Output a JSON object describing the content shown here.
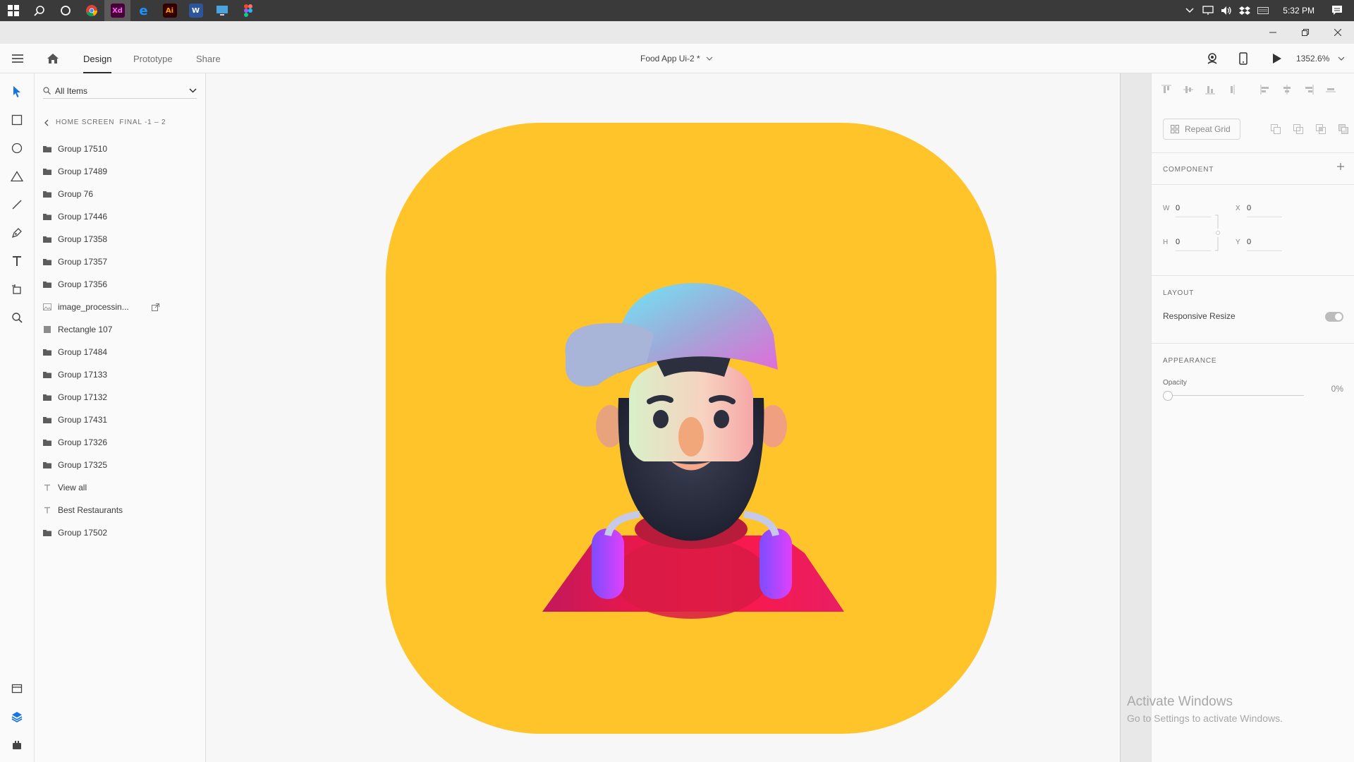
{
  "taskbar": {
    "clock": "5:32 PM",
    "apps": [
      {
        "icon": "chrome-icon"
      },
      {
        "icon": "adobe-xd-icon",
        "label": "Xd"
      },
      {
        "icon": "edge-icon"
      },
      {
        "icon": "adobe-illustrator-icon",
        "label": "Ai"
      },
      {
        "icon": "word-icon",
        "label": "W"
      },
      {
        "icon": "desktop-app-icon"
      },
      {
        "icon": "figma-icon"
      }
    ]
  },
  "header": {
    "tabs": [
      {
        "label": "Design",
        "active": true
      },
      {
        "label": "Prototype",
        "active": false
      },
      {
        "label": "Share",
        "active": false
      }
    ],
    "document_title": "Food App Ui-2 *",
    "zoom": "1352.6%"
  },
  "layers_panel": {
    "filter_label": "All Items",
    "breadcrumb": "HOME SCREEN  FINAL -1 – 2",
    "items": [
      {
        "label": "Group 17510",
        "type": "group"
      },
      {
        "label": "Group 17489",
        "type": "group"
      },
      {
        "label": "Group 76",
        "type": "group"
      },
      {
        "label": "Group 17446",
        "type": "group"
      },
      {
        "label": "Group 17358",
        "type": "group"
      },
      {
        "label": "Group 17357",
        "type": "group"
      },
      {
        "label": "Group 17356",
        "type": "group"
      },
      {
        "label": "image_processin...",
        "type": "image"
      },
      {
        "label": "Rectangle 107",
        "type": "rectangle"
      },
      {
        "label": "Group 17484",
        "type": "group"
      },
      {
        "label": "Group 17133",
        "type": "group"
      },
      {
        "label": "Group 17132",
        "type": "group"
      },
      {
        "label": "Group 17431",
        "type": "group"
      },
      {
        "label": "Group 17326",
        "type": "group"
      },
      {
        "label": "Group 17325",
        "type": "group"
      },
      {
        "label": "View all",
        "type": "text"
      },
      {
        "label": "Best Restaurants",
        "type": "text"
      },
      {
        "label": "Group 17502",
        "type": "group"
      }
    ]
  },
  "canvas": {
    "artboard_color": "#ffc429"
  },
  "properties": {
    "repeat_grid_label": "Repeat Grid",
    "component_title": "COMPONENT",
    "w_label": "W",
    "w_value": "0",
    "h_label": "H",
    "h_value": "0",
    "x_label": "X",
    "x_value": "0",
    "y_label": "Y",
    "y_value": "0",
    "layout_title": "LAYOUT",
    "responsive_resize_label": "Responsive Resize",
    "appearance_title": "APPEARANCE",
    "opacity_label": "Opacity",
    "opacity_value": "0%"
  },
  "watermark": {
    "title": "Activate Windows",
    "subtitle": "Go to Settings to activate Windows."
  }
}
